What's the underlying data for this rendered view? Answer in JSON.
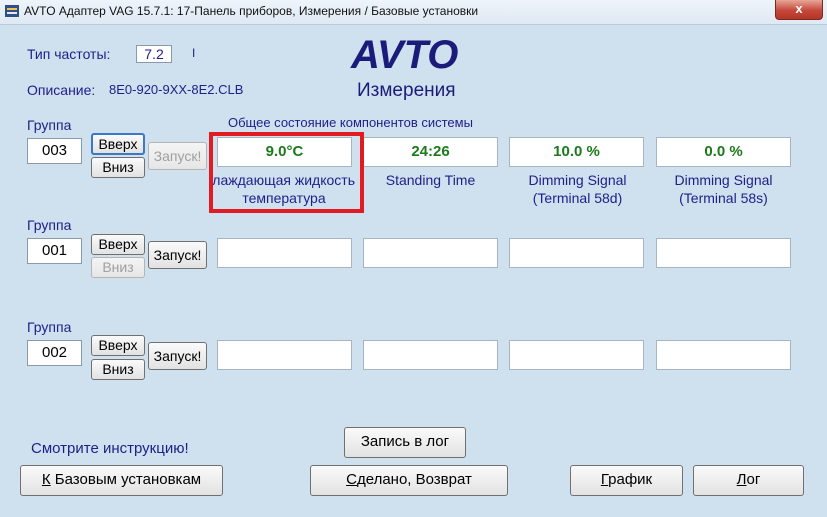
{
  "window": {
    "title": "AVTO Адаптер VAG 15.7.1: 17-Панель приборов,  Измерения / Базовые установки",
    "close_glyph": "x"
  },
  "header": {
    "freq_label": "Тип частоты:",
    "freq_value": "7.2",
    "freq_marker": "I",
    "desc_label": "Описание:",
    "desc_value": "8E0-920-9XX-8E2.CLB",
    "brand": "AVTO",
    "mode": "Измерения",
    "section_caption": "Общее состояние компонентов системы"
  },
  "groups": [
    {
      "label": "Группа",
      "number": "003",
      "up": "Вверх",
      "down": "Вниз",
      "start": "Запуск!",
      "fields": [
        {
          "value": "9.0°C",
          "label1": "Охлаждающая жидкость",
          "label2": "температура"
        },
        {
          "value": "24:26",
          "label1": "Standing Time",
          "label2": ""
        },
        {
          "value": "10.0 %",
          "label1": "Dimming Signal",
          "label2": "(Terminal 58d)"
        },
        {
          "value": "0.0 %",
          "label1": "Dimming Signal",
          "label2": "(Terminal 58s)"
        }
      ]
    },
    {
      "label": "Группа",
      "number": "001",
      "up": "Вверх",
      "down": "Вниз",
      "start": "Запуск!"
    },
    {
      "label": "Группа",
      "number": "002",
      "up": "Вверх",
      "down": "Вниз",
      "start": "Запуск!"
    }
  ],
  "footer": {
    "instructions": "Смотрите инструкцию!",
    "log_record": "Запись в лог",
    "basic_settings_key": "К",
    "basic_settings_rest": " Базовым установкам",
    "done_key": "С",
    "done_rest": "делано, Возврат",
    "graph_key": "Г",
    "graph_rest": "рафик",
    "log_key": "Л",
    "log_rest": "ог"
  },
  "colors": {
    "background": "#cfe0ee",
    "label_text": "#1f1e8a",
    "value_text": "#1b7a1b",
    "highlight": "#e01b22"
  },
  "icons": [
    "app-icon",
    "close-icon"
  ]
}
